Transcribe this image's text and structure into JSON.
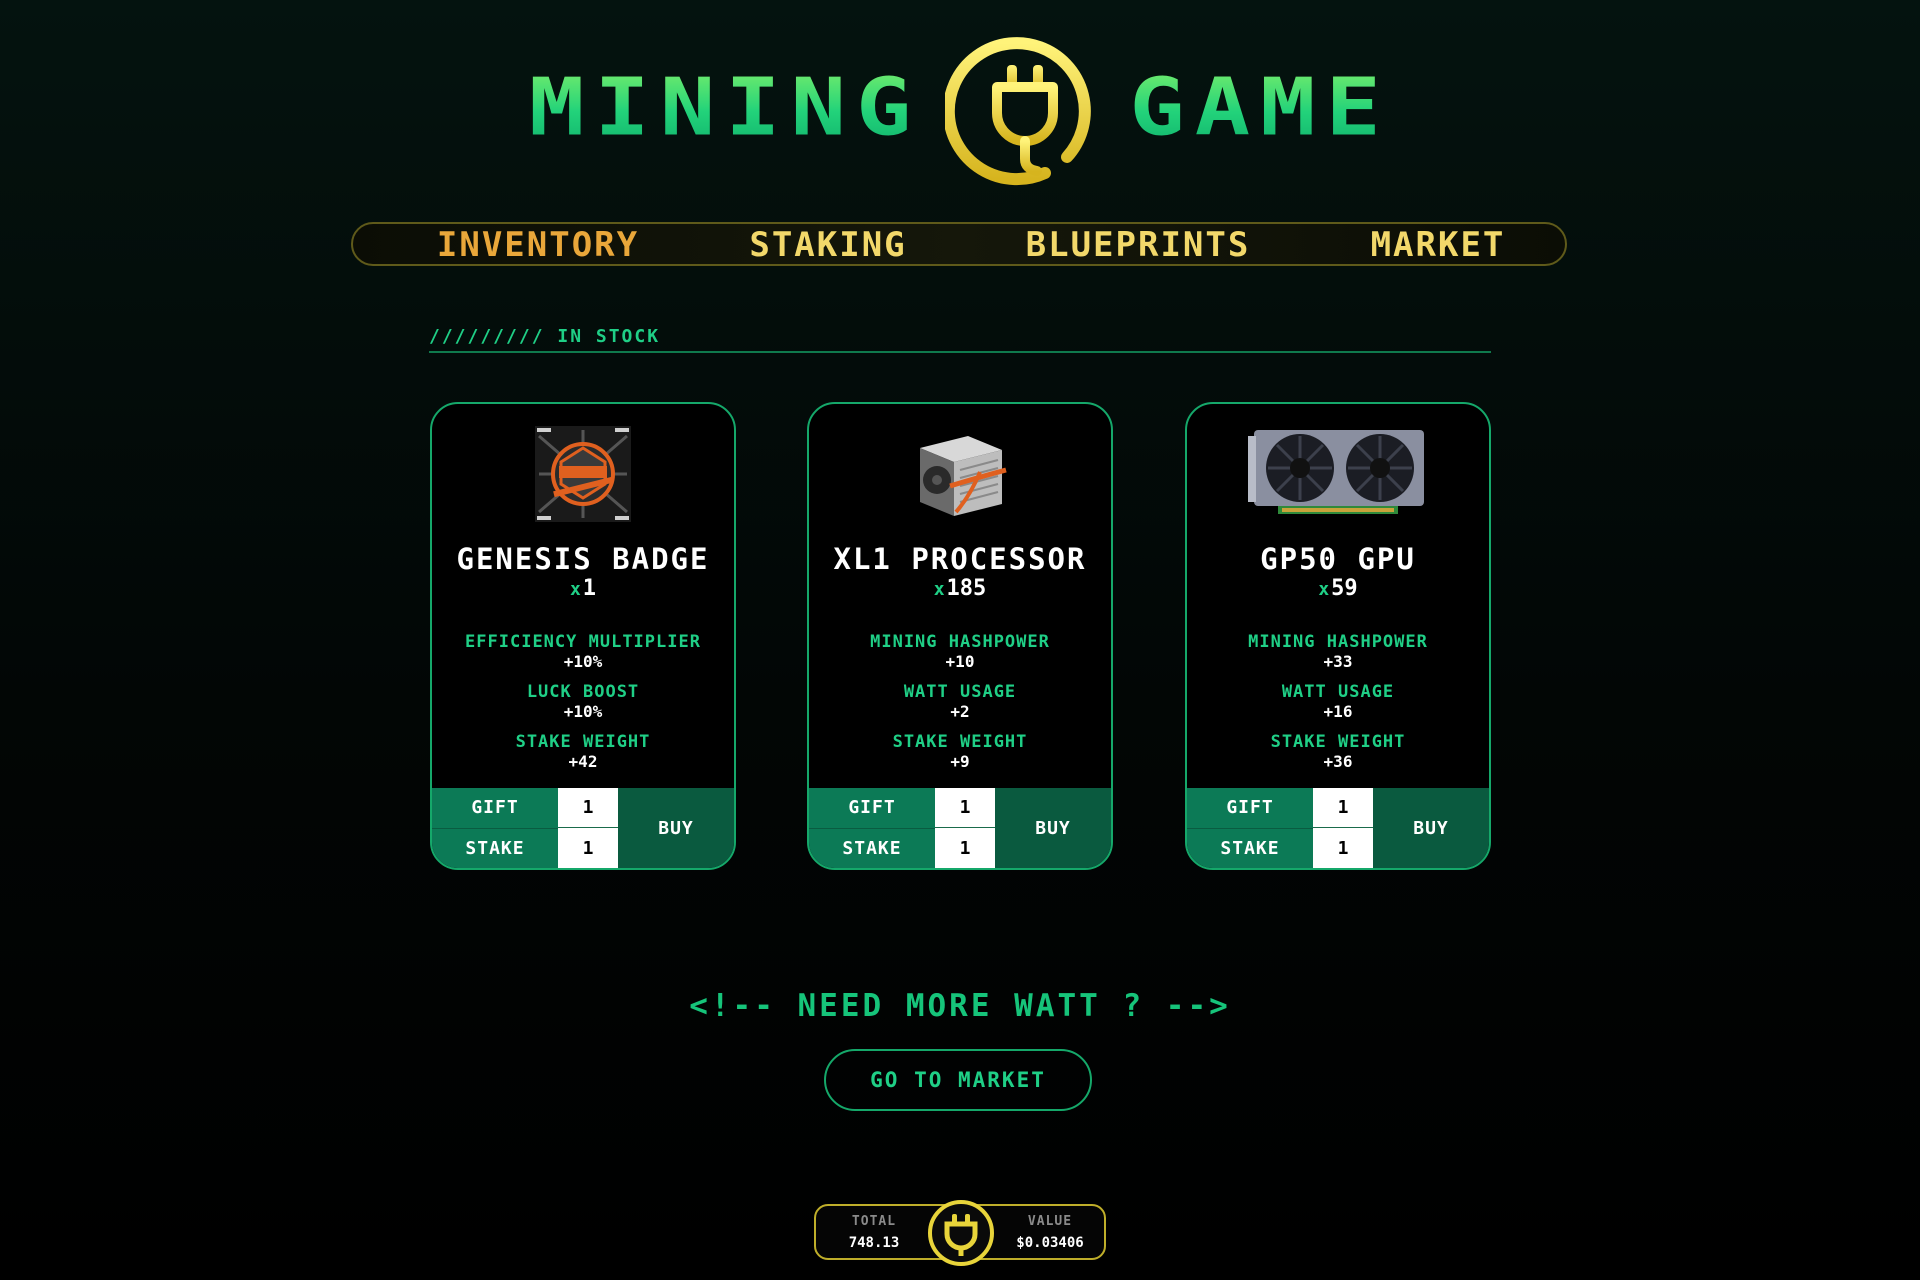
{
  "header": {
    "logo_left": "MINING",
    "logo_right": "GAME"
  },
  "nav": {
    "items": [
      {
        "label": "INVENTORY",
        "active": true
      },
      {
        "label": "STAKING",
        "active": false
      },
      {
        "label": "BLUEPRINTS",
        "active": false
      },
      {
        "label": "MARKET",
        "active": false
      }
    ]
  },
  "section": {
    "label": "///////// IN STOCK"
  },
  "cards": [
    {
      "name": "GENESIS BADGE",
      "qty_prefix": "x",
      "qty": "1",
      "image_icon": "genesis-badge-icon",
      "stats": [
        {
          "label": "EFFICIENCY MULTIPLIER",
          "value": "+10%"
        },
        {
          "label": "LUCK BOOST",
          "value": "+10%"
        },
        {
          "label": "STAKE WEIGHT",
          "value": "+42"
        }
      ],
      "gift_label": "GIFT",
      "stake_label": "STAKE",
      "gift_value": "1",
      "stake_value": "1",
      "buy_label": "BUY"
    },
    {
      "name": "XL1 PROCESSOR",
      "qty_prefix": "x",
      "qty": "185",
      "image_icon": "processor-icon",
      "stats": [
        {
          "label": "MINING HASHPOWER",
          "value": "+10"
        },
        {
          "label": "WATT USAGE",
          "value": "+2"
        },
        {
          "label": "STAKE WEIGHT",
          "value": "+9"
        }
      ],
      "gift_label": "GIFT",
      "stake_label": "STAKE",
      "gift_value": "1",
      "stake_value": "1",
      "buy_label": "BUY"
    },
    {
      "name": "GP50 GPU",
      "qty_prefix": "x",
      "qty": "59",
      "image_icon": "gpu-icon",
      "stats": [
        {
          "label": "MINING HASHPOWER",
          "value": "+33"
        },
        {
          "label": "WATT USAGE",
          "value": "+16"
        },
        {
          "label": "STAKE WEIGHT",
          "value": "+36"
        }
      ],
      "gift_label": "GIFT",
      "stake_label": "STAKE",
      "gift_value": "1",
      "stake_value": "1",
      "buy_label": "BUY"
    }
  ],
  "cta": {
    "need_more_watt": "<!-- NEED MORE WATT ? -->",
    "go_to_market": "GO TO MARKET"
  },
  "footer": {
    "total_label": "TOTAL",
    "total_value": "748.13",
    "value_label": "VALUE",
    "value_value": "$0.03406"
  },
  "colors": {
    "accent_green": "#1fcf86",
    "gold": "#f2d86a",
    "active_nav": "#e9a73a",
    "button_green": "#0c7a56"
  }
}
